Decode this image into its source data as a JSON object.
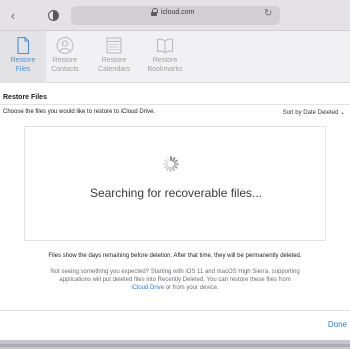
{
  "browser": {
    "url": "icloud.com",
    "back_icon": "chevron-left-icon",
    "privacy_icon": "privacy-report-icon",
    "lock_icon": "lock-icon",
    "reload_icon": "reload-icon"
  },
  "tabs": [
    {
      "label_line1": "Restore",
      "label_line2": "Files",
      "icon": "document-icon",
      "active": true
    },
    {
      "label_line1": "Restore",
      "label_line2": "Contacts",
      "icon": "contacts-icon",
      "active": false
    },
    {
      "label_line1": "Restore",
      "label_line2": "Calendars",
      "icon": "calendar-icon",
      "active": false
    },
    {
      "label_line1": "Restore",
      "label_line2": "Bookmarks",
      "icon": "book-icon",
      "active": false
    }
  ],
  "main": {
    "title": "Restore Files",
    "instructions": "Choose the files you would like to restore to iCloud Drive.",
    "sort_label": "Sort by Date Deleted",
    "sort_icon": "chevron-down-icon",
    "status_text": "Searching for recoverable files...",
    "days_note": "Files show the days remaining before deletion. After that time, they will be permanently deleted.",
    "help_text_1": "Not seeing something you expected? Starting with iOS 11 and macOS High Sierra, supporting",
    "help_text_2": "applications will put deleted files into Recently Deleted. You can restore these files from",
    "help_link": "iCloud Drive",
    "help_text_3": " or from your device.",
    "done_label": "Done"
  },
  "colors": {
    "accent": "#2b7bd9",
    "active_tab_text": "#4a90d9",
    "inactive_tab_text": "#a1a1a6"
  }
}
